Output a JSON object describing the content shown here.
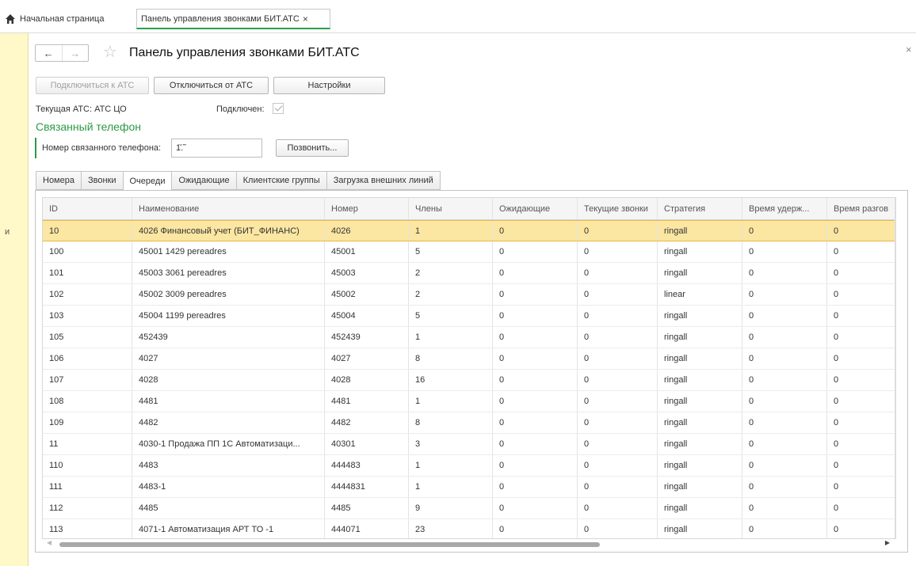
{
  "top_tabs": {
    "home_label": "Начальная страница",
    "active_label": "Панель управления звонками БИТ.АТС",
    "close_glyph": "×"
  },
  "left_strip": {
    "stub_text": "и"
  },
  "header": {
    "back_glyph": "←",
    "forward_glyph": "→",
    "star_glyph": "☆",
    "title": "Панель управления звонками БИТ.АТС",
    "close_glyph": "×"
  },
  "buttons": {
    "connect": "Подключиться к АТС",
    "disconnect": "Отключиться от АТС",
    "settings": "Настройки",
    "call": "Позвонить..."
  },
  "status": {
    "current_pbx": "Текущая АТС:  АТС ЦО",
    "connected_label": "Подключен:",
    "connected": true
  },
  "linked_phone": {
    "section_title": "Связанный телефон",
    "label": "Номер связанного телефона:",
    "value": "1̆.̃"
  },
  "tabs": [
    {
      "label": "Номера"
    },
    {
      "label": "Звонки"
    },
    {
      "label": "Очереди",
      "active": true
    },
    {
      "label": "Ожидающие"
    },
    {
      "label": "Клиентские группы"
    },
    {
      "label": "Загрузка внешних линий"
    }
  ],
  "table": {
    "columns": [
      "ID",
      "Наименование",
      "Номер",
      "Члены",
      "Ожидающие",
      "Текущие звонки",
      "Стратегия",
      "Время удерж...",
      "Время разгов"
    ],
    "rows": [
      [
        "10",
        "4026 Финансовый учет (БИТ_ФИНАНС)",
        "4026",
        "1",
        "0",
        "0",
        "ringall",
        "0",
        "0"
      ],
      [
        "100",
        "45001 1429 pereadres",
        "45001",
        "5",
        "0",
        "0",
        "ringall",
        "0",
        "0"
      ],
      [
        "101",
        "45003 3061 pereadres",
        "45003",
        "2",
        "0",
        "0",
        "ringall",
        "0",
        "0"
      ],
      [
        "102",
        "45002 3009 pereadres",
        "45002",
        "2",
        "0",
        "0",
        "linear",
        "0",
        "0"
      ],
      [
        "103",
        "45004 1199 pereadres",
        "45004",
        "5",
        "0",
        "0",
        "ringall",
        "0",
        "0"
      ],
      [
        "105",
        "452439",
        "452439",
        "1",
        "0",
        "0",
        "ringall",
        "0",
        "0"
      ],
      [
        "106",
        "4027",
        "4027",
        "8",
        "0",
        "0",
        "ringall",
        "0",
        "0"
      ],
      [
        "107",
        "4028",
        "4028",
        "16",
        "0",
        "0",
        "ringall",
        "0",
        "0"
      ],
      [
        "108",
        "4481",
        "4481",
        "1",
        "0",
        "0",
        "ringall",
        "0",
        "0"
      ],
      [
        "109",
        "4482",
        "4482",
        "8",
        "0",
        "0",
        "ringall",
        "0",
        "0"
      ],
      [
        "11",
        "4030-1 Продажа ПП 1С Автоматизаци...",
        "40301",
        "3",
        "0",
        "0",
        "ringall",
        "0",
        "0"
      ],
      [
        "110",
        "4483",
        "444483",
        "1",
        "0",
        "0",
        "ringall",
        "0",
        "0"
      ],
      [
        "111",
        "4483-1",
        "4444831",
        "1",
        "0",
        "0",
        "ringall",
        "0",
        "0"
      ],
      [
        "112",
        "4485",
        "4485",
        "9",
        "0",
        "0",
        "ringall",
        "0",
        "0"
      ],
      [
        "113",
        "4071-1 Автоматизация АРТ ТО -1",
        "444071",
        "23",
        "0",
        "0",
        "ringall",
        "0",
        "0"
      ]
    ],
    "selected_row": 0
  },
  "colors": {
    "accent_green": "#2b9a45",
    "selected_row": "#fbe6a2",
    "left_strip": "#fff8c8"
  }
}
